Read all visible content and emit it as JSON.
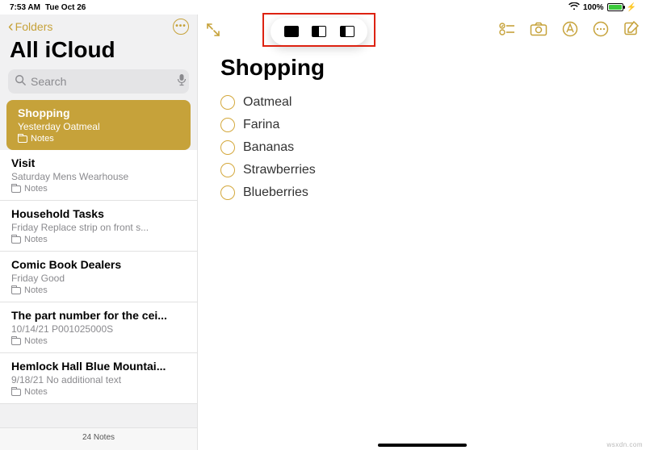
{
  "status": {
    "time": "7:53 AM",
    "date": "Tue Oct 26",
    "battery_pct": "100%"
  },
  "sidebar": {
    "back_label": "Folders",
    "title": "All iCloud",
    "search_placeholder": "Search",
    "folder_label": "Notes",
    "footer": "24 Notes",
    "notes": [
      {
        "title": "Shopping",
        "sub": "Yesterday  Oatmeal"
      },
      {
        "title": "Visit",
        "sub": "Saturday  Mens Wearhouse"
      },
      {
        "title": "Household Tasks",
        "sub": "Friday  Replace strip on front s..."
      },
      {
        "title": "Comic Book Dealers",
        "sub": "Friday  Good"
      },
      {
        "title": "The part number for the cei...",
        "sub": "10/14/21  P001025000S"
      },
      {
        "title": "Hemlock Hall Blue Mountai...",
        "sub": "9/18/21  No additional text"
      }
    ]
  },
  "content": {
    "title": "Shopping",
    "items": [
      "Oatmeal",
      "Farina",
      "Bananas",
      "Strawberries",
      "Blueberries"
    ]
  },
  "watermark": "wsxdn.com"
}
